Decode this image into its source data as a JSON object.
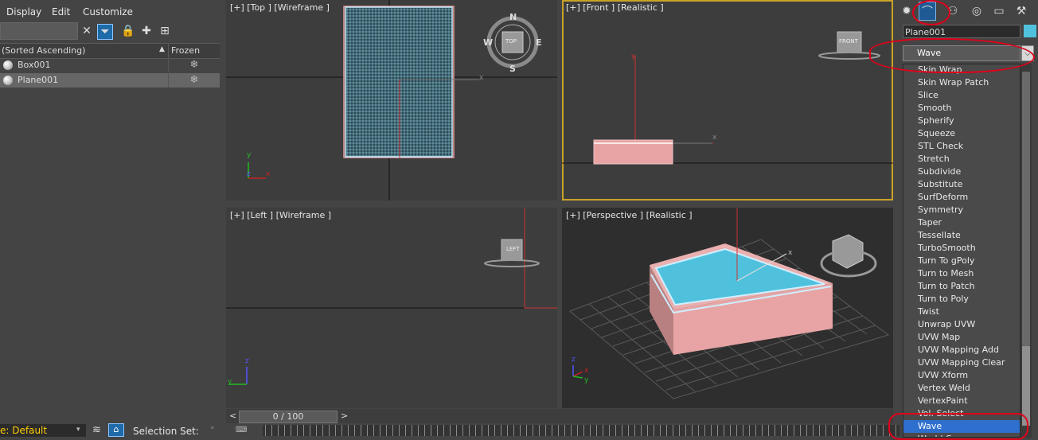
{
  "menus": [
    "Display",
    "Edit",
    "Customize"
  ],
  "explorer": {
    "header": {
      "sort_label": "(Sorted Ascending)",
      "frozen_label": "Frozen"
    },
    "rows": [
      {
        "name": "Box001",
        "frozen_icon": "snowflake-icon"
      },
      {
        "name": "Plane001",
        "frozen_icon": "snowflake-icon",
        "selected": true
      }
    ]
  },
  "viewports": {
    "top": {
      "label": "[+] [Top ] [Wireframe ]",
      "cube": "TOP",
      "compass": [
        "N",
        "E",
        "S",
        "W"
      ]
    },
    "front": {
      "label": "[+] [Front ] [Realistic ]",
      "cube": "FRONT"
    },
    "left": {
      "label": "[+] [Left ] [Wireframe ]",
      "cube": "LEFT"
    },
    "perspective": {
      "label": "[+] [Perspective ] [Realistic ]"
    }
  },
  "axes": {
    "x": "x",
    "y": "y",
    "z": "z"
  },
  "timeline": {
    "frame": "0 / 100",
    "prev": "<",
    "next": ">"
  },
  "status": {
    "layer": "e: Default",
    "selection_set": "Selection Set:"
  },
  "command_panel": {
    "object_name": "Plane001",
    "object_color": "#4fc1dd",
    "modifier_selected": "Wave",
    "modifier_list": [
      "Skin Wrap",
      "Skin Wrap Patch",
      "Slice",
      "Smooth",
      "Spherify",
      "Squeeze",
      "STL Check",
      "Stretch",
      "Subdivide",
      "Substitute",
      "SurfDeform",
      "Symmetry",
      "Taper",
      "Tessellate",
      "TurboSmooth",
      "Turn To gPoly",
      "Turn to Mesh",
      "Turn to Patch",
      "Turn to Poly",
      "Twist",
      "Unwrap UVW",
      "UVW Map",
      "UVW Mapping Add",
      "UVW Mapping Clear",
      "UVW Xform",
      "Vertex Weld",
      "VertexPaint",
      "Vol. Select",
      "Wave",
      "World-Space"
    ],
    "highlighted_item": "Wave"
  },
  "colors": {
    "accent": "#2f6fce",
    "annotation": "#e0001a",
    "water": "#4fc1dd",
    "box": "#e8a4a4",
    "active_viewport": "#c9a227"
  }
}
